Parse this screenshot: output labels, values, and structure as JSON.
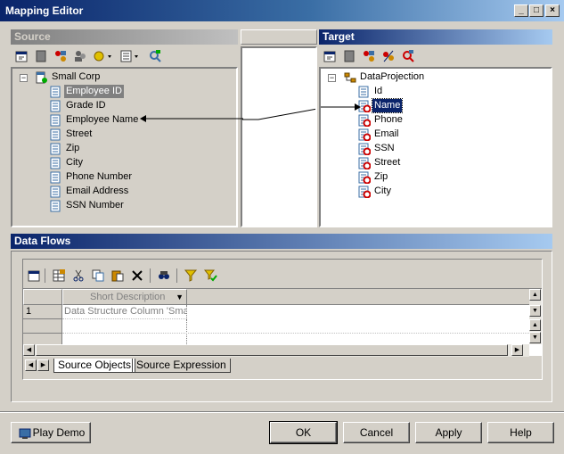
{
  "window": {
    "title": "Mapping Editor"
  },
  "source": {
    "header": "Source",
    "root": "Small Corp",
    "items": [
      "Employee ID",
      "Grade ID",
      "Employee Name",
      "Street",
      "Zip",
      "City",
      "Phone Number",
      "Email Address",
      "SSN Number"
    ]
  },
  "target": {
    "header": "Target",
    "root": "DataProjection",
    "items": [
      "Id",
      "Name",
      "Phone",
      "Email",
      "SSN",
      "Street",
      "Zip",
      "City"
    ]
  },
  "data_flows": {
    "header": "Data Flows",
    "column_header": "Short Description",
    "rows": [
      {
        "num": "1",
        "description": "Data Structure Column 'Smal"
      }
    ],
    "tabs": [
      "Source Objects",
      "Source Expression"
    ]
  },
  "buttons": {
    "play_demo": "Play Demo",
    "ok": "OK",
    "cancel": "Cancel",
    "apply": "Apply",
    "help": "Help"
  },
  "colors": {
    "title_gradient_start": "#0a246a",
    "active_header": "#0a246a",
    "selection_gray": "#808080",
    "selection_blue": "#0a246a",
    "face": "#d4d0c8"
  }
}
